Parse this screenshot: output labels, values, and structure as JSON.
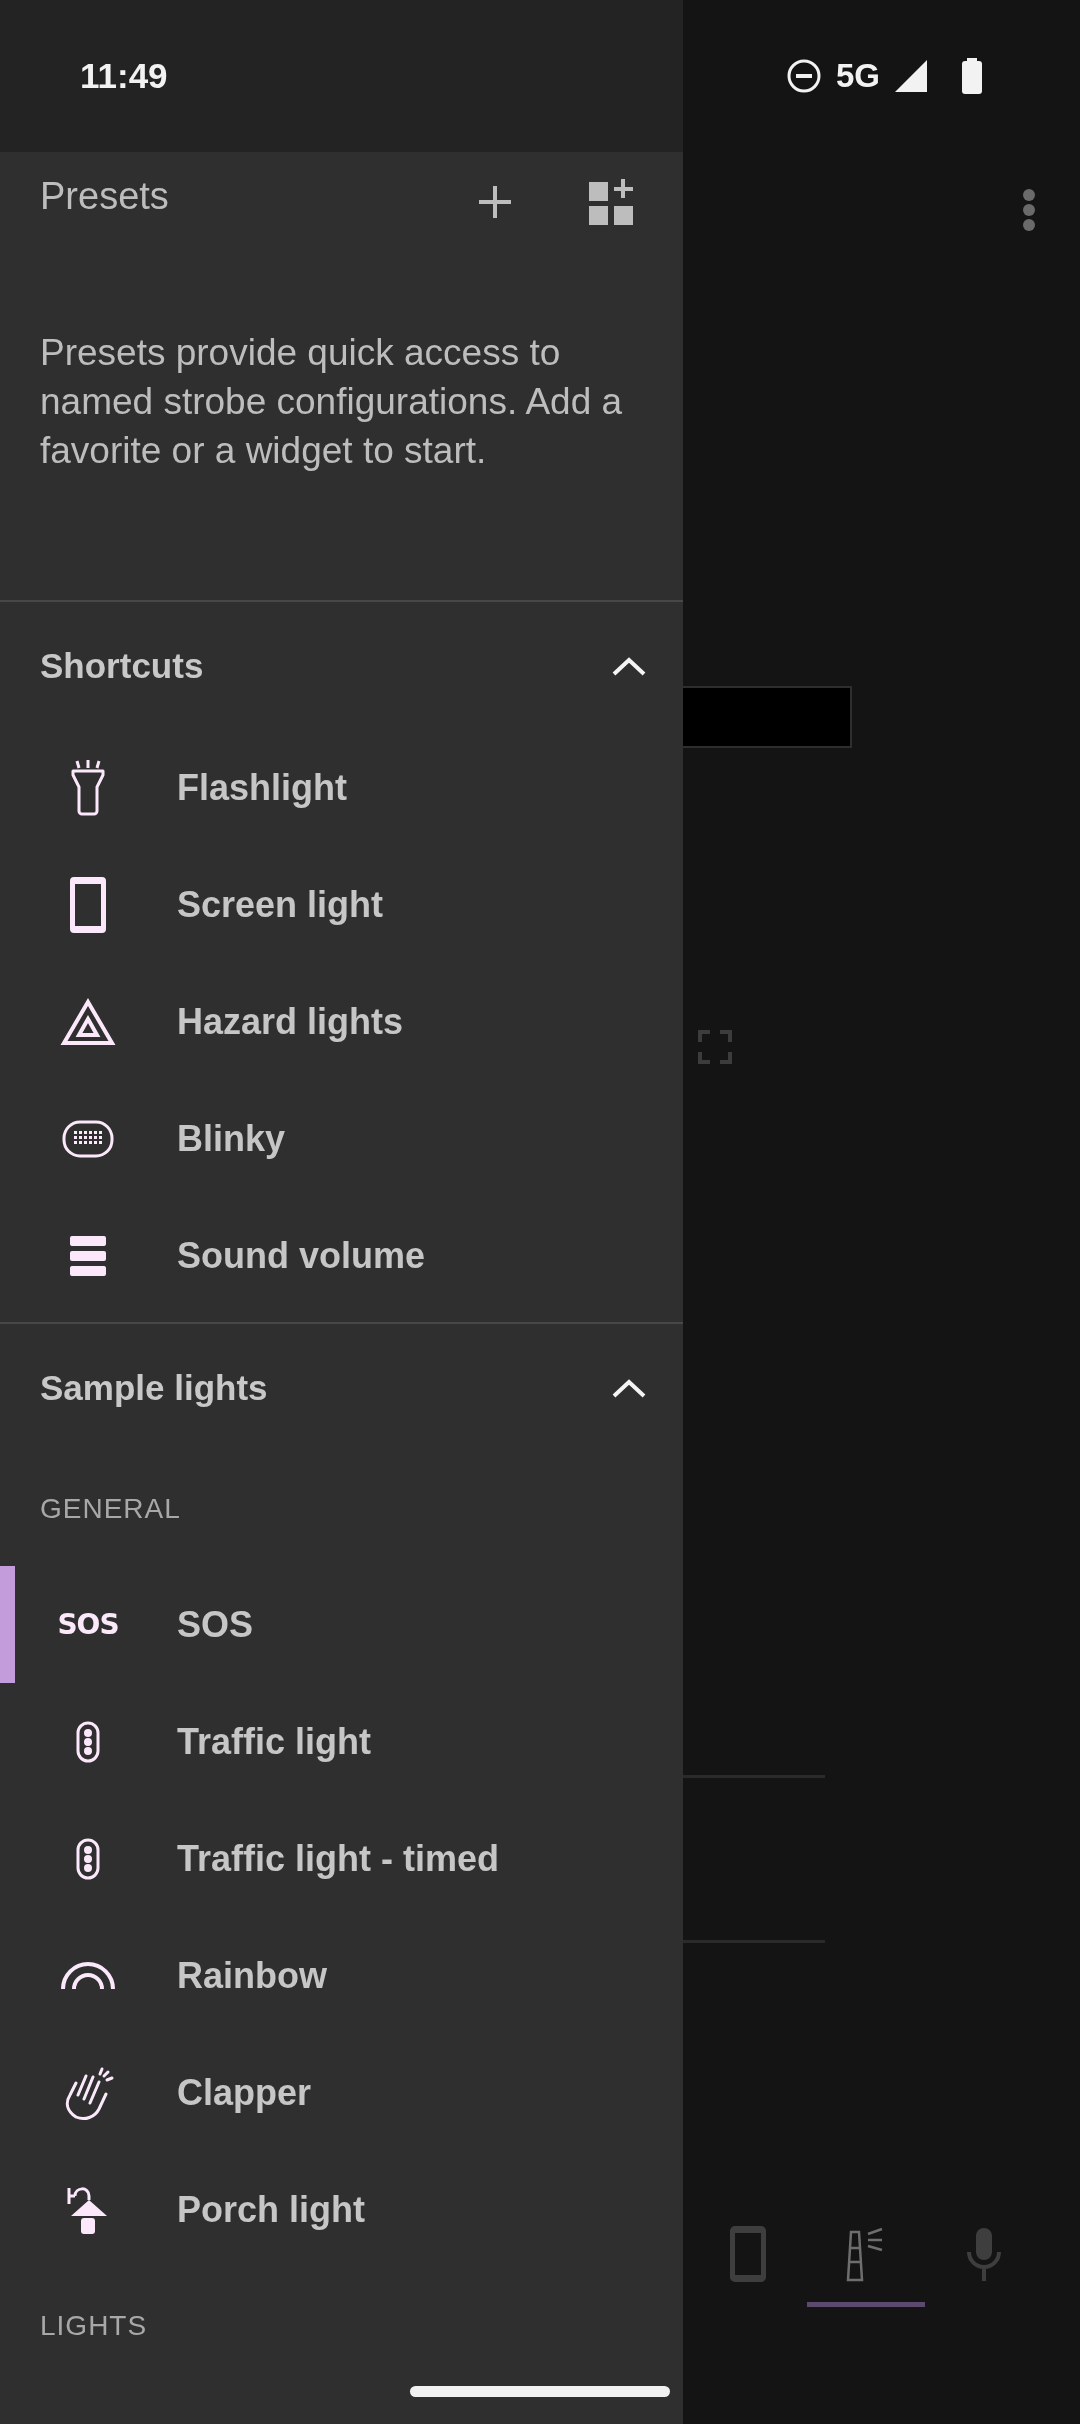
{
  "status_bar": {
    "time": "11:49",
    "network": "5G"
  },
  "app": {
    "bottom_nav": [
      {
        "kind": "phone",
        "selected": false
      },
      {
        "kind": "lighthouse",
        "selected": true
      },
      {
        "kind": "mic",
        "selected": false
      }
    ]
  },
  "drawer": {
    "title": "Presets",
    "description": "Presets provide quick access to named strobe configurations. Add a favorite or a widget to start.",
    "sections": [
      {
        "title": "Shortcuts",
        "expanded": true,
        "groups": [
          {
            "items": [
              {
                "label": "Flashlight",
                "kind": "flashlight",
                "selected": false
              },
              {
                "label": "Screen light",
                "kind": "phone",
                "selected": false
              },
              {
                "label": "Hazard lights",
                "kind": "hazard",
                "selected": false
              },
              {
                "label": "Blinky",
                "kind": "blinky",
                "selected": false
              },
              {
                "label": "Sound volume",
                "kind": "volume",
                "selected": false
              }
            ]
          }
        ]
      },
      {
        "title": "Sample lights",
        "expanded": true,
        "groups": [
          {
            "heading": "GENERAL",
            "items": [
              {
                "label": "SOS",
                "kind": "text",
                "icon_text": "SOS",
                "selected": true
              },
              {
                "label": "Traffic light",
                "kind": "traffic",
                "selected": false
              },
              {
                "label": "Traffic light - timed",
                "kind": "traffic",
                "selected": false
              },
              {
                "label": "Rainbow",
                "kind": "rainbow",
                "selected": false
              },
              {
                "label": "Clapper",
                "kind": "clapper",
                "selected": false
              },
              {
                "label": "Porch light",
                "kind": "porch",
                "selected": false
              }
            ]
          },
          {
            "heading": "LIGHTS"
          }
        ]
      }
    ]
  }
}
